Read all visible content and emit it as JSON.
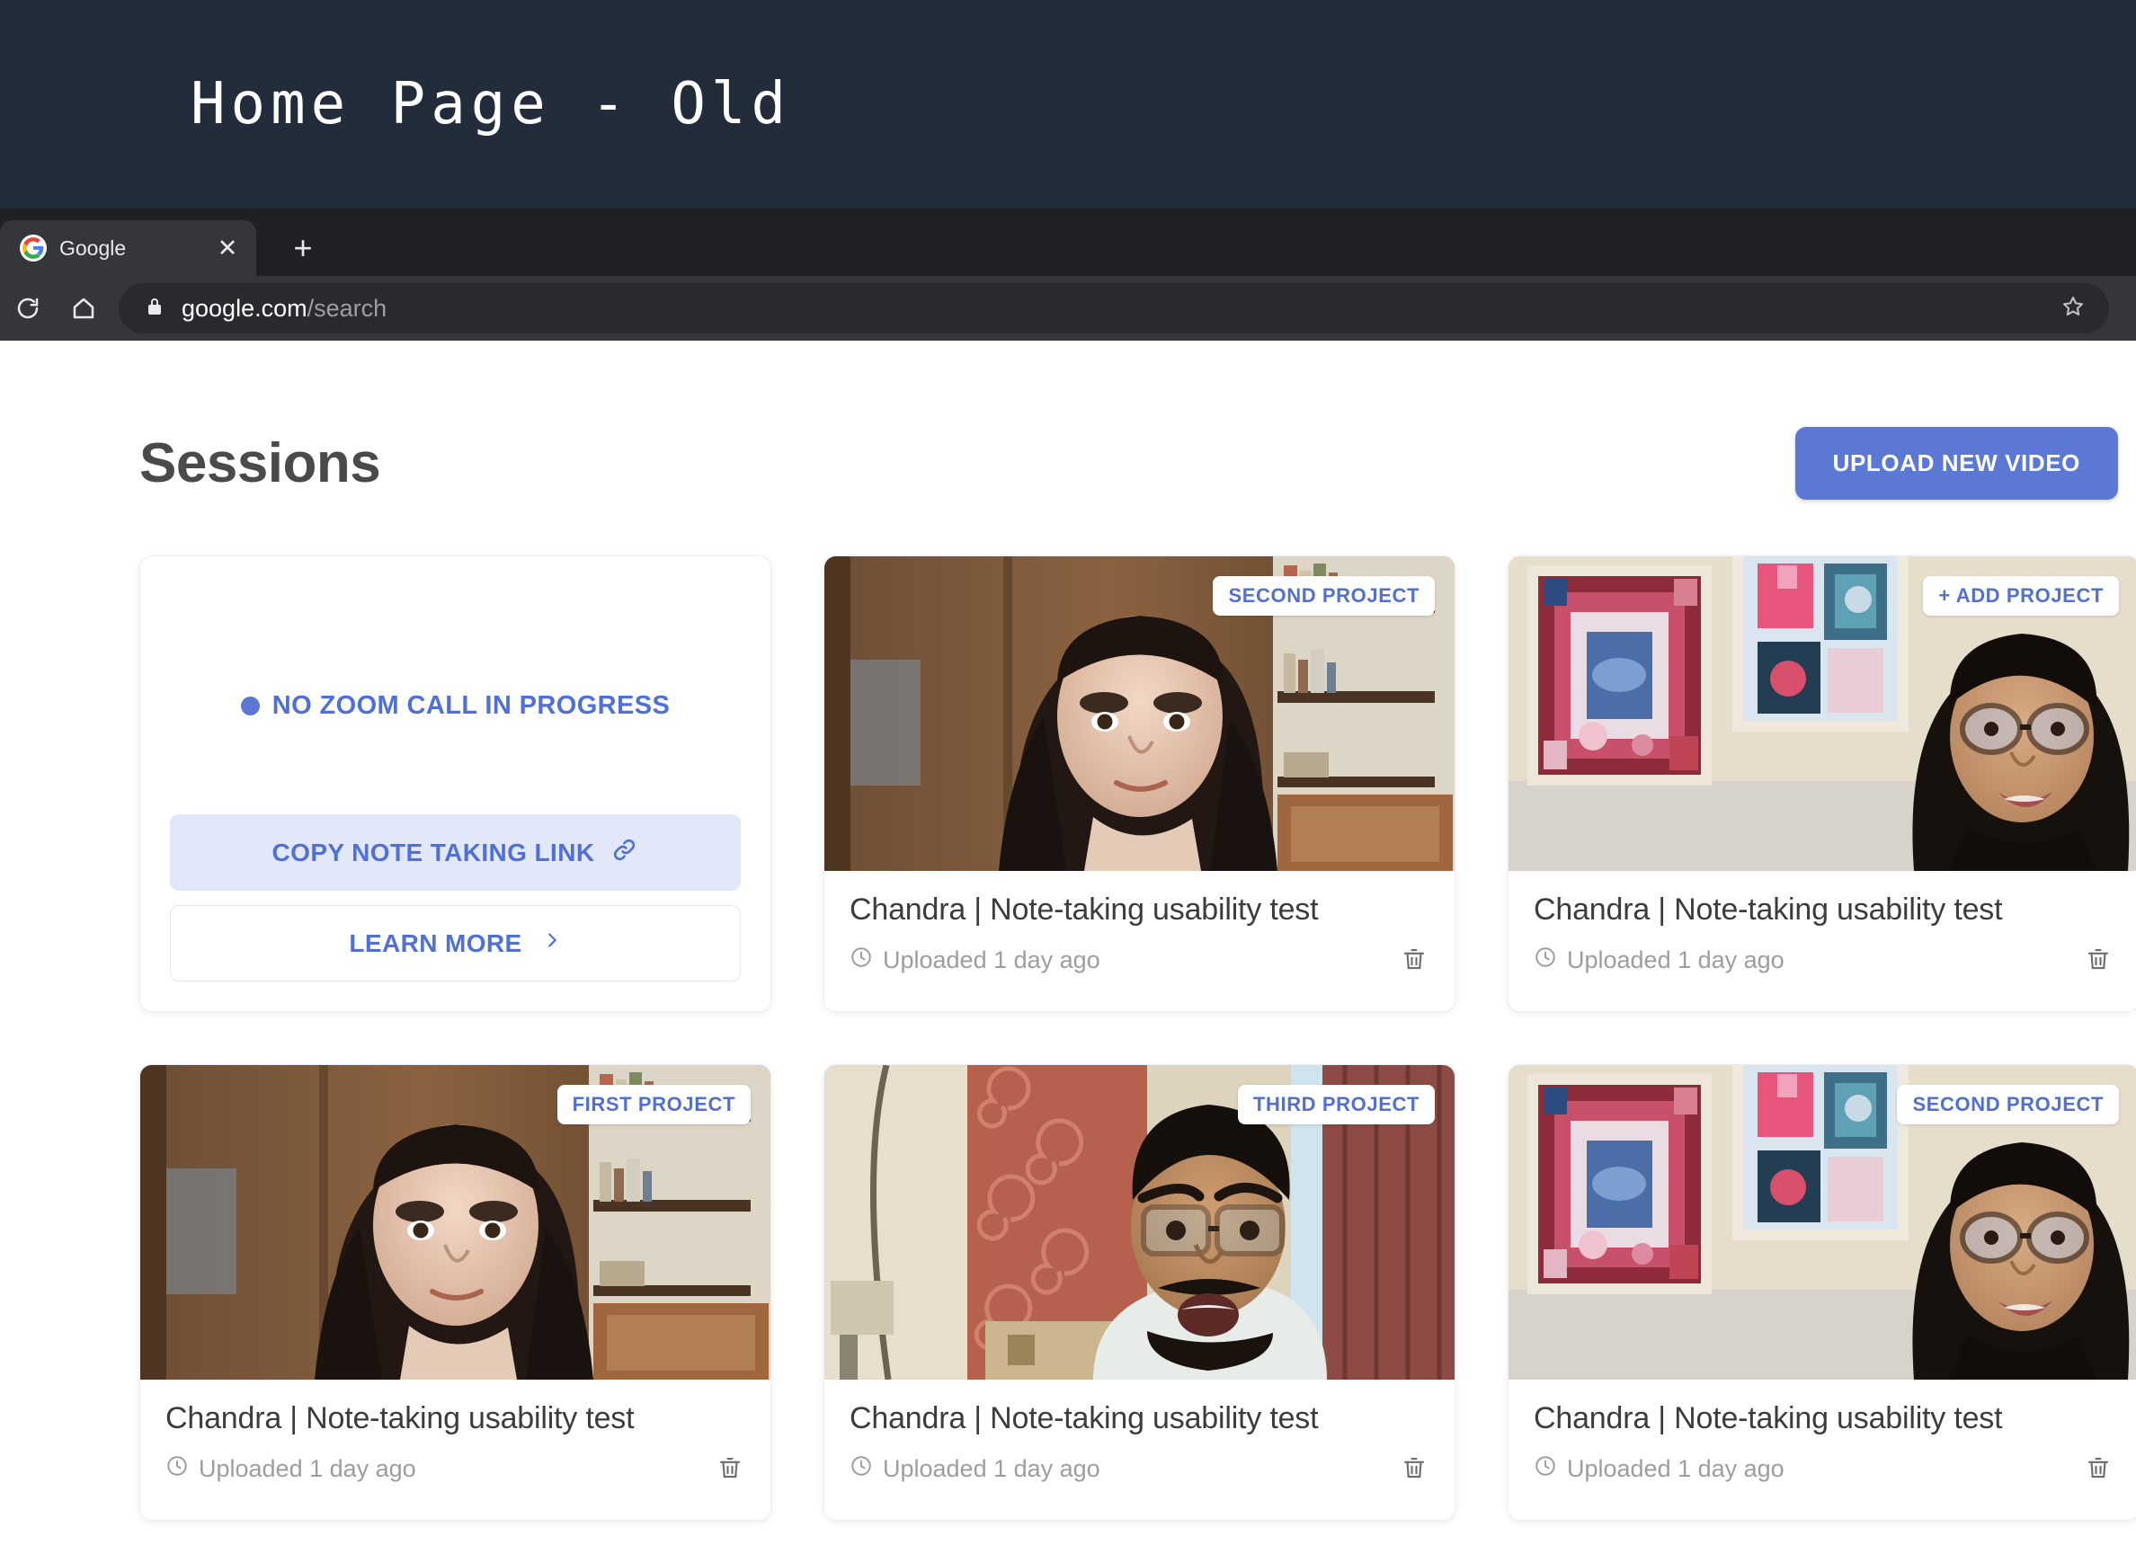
{
  "annotation": {
    "title": "Home Page - Old"
  },
  "browser": {
    "tab": {
      "title": "Google",
      "favicon": "google-favicon",
      "close": "✕"
    },
    "new_tab": "+",
    "reload_icon": "reload-icon",
    "home_icon": "home-icon",
    "lock_icon": "lock-icon",
    "star_icon": "star-icon",
    "url_domain": "google.com",
    "url_path": "/search"
  },
  "page": {
    "title": "Sessions",
    "upload_label": "UPLOAD NEW VIDEO",
    "accent_color": "#5a78d4"
  },
  "status_card": {
    "status_text": "NO ZOOM CALL IN PROGRESS",
    "dot_color": "#5a78d4",
    "copy_label": "COPY NOTE TAKING LINK",
    "learn_label": "LEARN MORE"
  },
  "cards": [
    {
      "badge": "SECOND PROJECT",
      "title": "Chandra | Note-taking usability test",
      "uploaded": "Uploaded 1 day ago",
      "thumb": "woman-bookshelf"
    },
    {
      "badge": "+ ADD PROJECT",
      "title": "Chandra | Note-taking usability test",
      "uploaded": "Uploaded 1 day ago",
      "thumb": "woman-glasses-quilts"
    },
    {
      "badge": "FIRST PROJECT",
      "title": "Chandra | Note-taking usability test",
      "uploaded": "Uploaded 1 day ago",
      "thumb": "woman-bookshelf"
    },
    {
      "badge": "THIRD PROJECT",
      "title": "Chandra | Note-taking usability test",
      "uploaded": "Uploaded 1 day ago",
      "thumb": "man-glasses-red-wall"
    },
    {
      "badge": "SECOND PROJECT",
      "title": "Chandra | Note-taking usability test",
      "uploaded": "Uploaded 1 day ago",
      "thumb": "woman-glasses-quilts"
    }
  ]
}
